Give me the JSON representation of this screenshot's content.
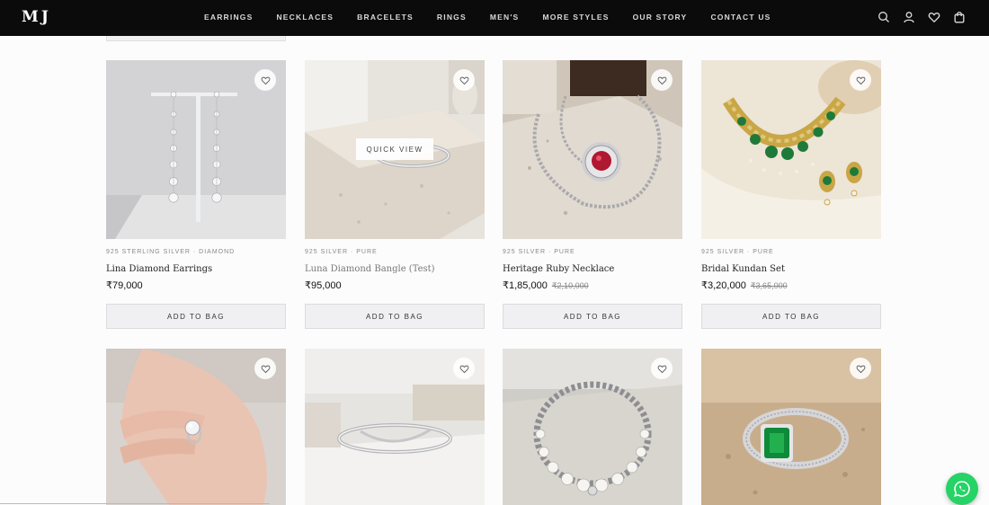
{
  "brand": {
    "logo": "MJ"
  },
  "nav": {
    "links": [
      "EARRINGS",
      "NECKLACES",
      "BRACELETS",
      "RINGS",
      "MEN'S",
      "MORE STYLES",
      "OUR STORY",
      "CONTACT US"
    ],
    "icons": [
      "search-icon",
      "account-icon",
      "wishlist-icon",
      "bag-icon"
    ]
  },
  "products": [
    {
      "meta": "925 STERLING SILVER · DIAMOND",
      "name": "Lina Diamond Earrings",
      "price": "₹79,000",
      "old_price": "",
      "cta": "ADD TO BAG"
    },
    {
      "meta": "925 SILVER · PURE",
      "name": "Luna Diamond Bangle (Test)",
      "price": "₹95,000",
      "old_price": "",
      "cta": "ADD TO BAG",
      "overlay": "QUICK VIEW"
    },
    {
      "meta": "925 SILVER · PURE",
      "name": "Heritage Ruby Necklace",
      "price": "₹1,85,000",
      "old_price": "₹2,10,000",
      "cta": "ADD TO BAG"
    },
    {
      "meta": "925 SILVER · PURE",
      "name": "Bridal Kundan Set",
      "price": "₹3,20,000",
      "old_price": "₹3,65,000",
      "cta": "ADD TO BAG"
    }
  ],
  "colors": {
    "nav_bg": "#0b0b0b",
    "whatsapp": "#25d366",
    "button_bg": "#f0f0f3"
  }
}
